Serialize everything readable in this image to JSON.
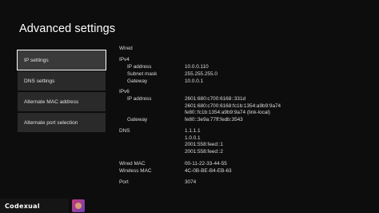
{
  "page": {
    "title": "Advanced settings"
  },
  "menu": {
    "items": [
      {
        "label": "IP settings"
      },
      {
        "label": "DNS settings"
      },
      {
        "label": "Alternate MAC address"
      },
      {
        "label": "Alternate port selection"
      }
    ],
    "selected": "IP settings"
  },
  "details": {
    "wired_heading": "Wired",
    "ipv4_heading": "IPv4",
    "ipv4": {
      "ip_label": "IP address",
      "ip_value": "10.0.0.110",
      "mask_label": "Subnet mask",
      "mask_value": "255.255.255.0",
      "gw_label": "Gateway",
      "gw_value": "10.0.0.1"
    },
    "ipv6_heading": "IPv6",
    "ipv6": {
      "ip_label": "IP address",
      "ip_values": [
        "2601:680:c700:6168::331d",
        "2601:680:c700:6168:fc1b:1354:a9b9:9a74",
        "fe80::fc1b:1354:a9b9:9a74 (link-local)"
      ],
      "gw_label": "Gateway",
      "gw_value": "fe80::3e9a:77ff:fedb:3543"
    },
    "dns_label": "DNS",
    "dns_values": [
      "1.1.1.1",
      "1.0.0.1",
      "2001:558:feed::1",
      "2001:558:feed::2"
    ],
    "wired_mac_label": "Wired MAC",
    "wired_mac_value": "00-11-22-33-44-55",
    "wireless_mac_label": "Wireless MAC",
    "wireless_mac_value": "4C-0B-BE-B4-EB-63",
    "port_label": "Port",
    "port_value": "3074"
  },
  "watermark": {
    "text": "Codexual"
  }
}
